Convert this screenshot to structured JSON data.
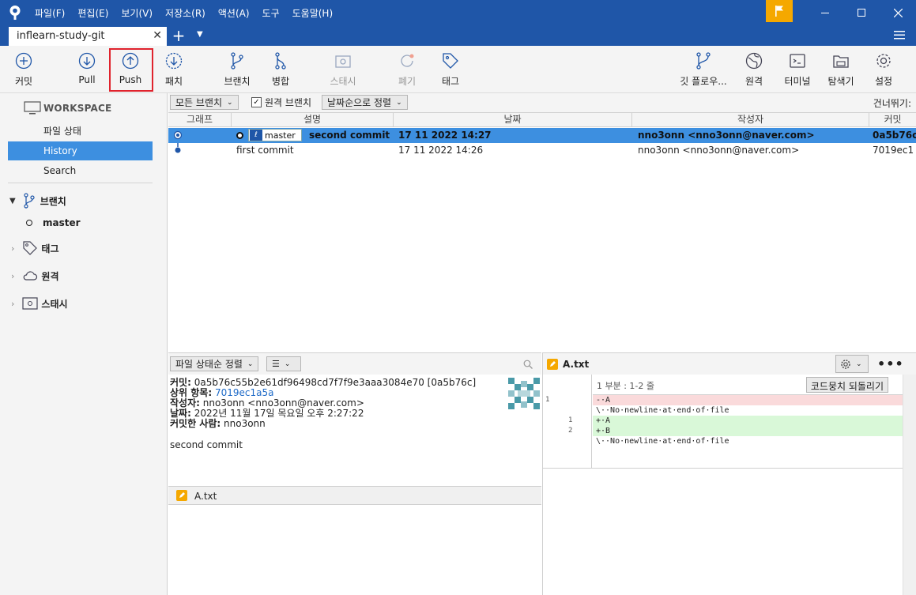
{
  "menubar": [
    "파일(F)",
    "편집(E)",
    "보기(V)",
    "저장소(R)",
    "액션(A)",
    "도구",
    "도움말(H)"
  ],
  "tab": {
    "title": "inflearn-study-git"
  },
  "toolbar": {
    "commit": "커밋",
    "pull": "Pull",
    "push": "Push",
    "fetch": "패치",
    "branch": "브랜치",
    "merge": "병합",
    "stash": "스태시",
    "discard": "폐기",
    "tag": "태그",
    "gitflow": "깃 플로우...",
    "remote": "원격",
    "terminal": "터미널",
    "explorer": "탐색기",
    "settings": "설정"
  },
  "sidebar": {
    "workspace": "WORKSPACE",
    "file_status": "파일 상태",
    "history": "History",
    "search": "Search",
    "branches": "브랜치",
    "branch_master": "master",
    "tags": "태그",
    "remotes": "원격",
    "stashes": "스태시"
  },
  "filter": {
    "all_branches": "모든 브랜치",
    "remote_branches": "원격 브랜치",
    "sort_by_date": "날짜순으로 정렬",
    "jump_to": "건너뛰기:"
  },
  "history": {
    "headers": {
      "graph": "그래프",
      "description": "설명",
      "date": "날짜",
      "author": "작성자",
      "commit": "커밋"
    },
    "rows": [
      {
        "branch": "master",
        "description": "second commit",
        "date": "17 11 2022 14:27",
        "author": "nno3onn <nno3onn@naver.com>",
        "commit": "0a5b76c"
      },
      {
        "description": "first commit",
        "date": "17 11 2022 14:26",
        "author": "nno3onn <nno3onn@naver.com>",
        "commit": "7019ec1"
      }
    ]
  },
  "details": {
    "sort_label": "파일 상태순 정렬",
    "commit_label": "커밋:",
    "commit_value": "0a5b76c55b2e61df96498cd7f7f9e3aaa3084e70 [0a5b76c]",
    "parent_label": "상위 항목:",
    "parent_value": "7019ec1a5a",
    "author_label": "작성자:",
    "author_value": "nno3onn <nno3onn@naver.com>",
    "date_label": "날짜:",
    "date_value": "2022년 11월 17일 목요일 오후 2:27:22",
    "committer_label": "커밋한 사람:",
    "committer_value": "nno3onn",
    "message": "second commit",
    "file": "A.txt"
  },
  "diff": {
    "file": "A.txt",
    "hunk": "1 부분 : 1-2 줄",
    "revert": "코드뭉치 되돌리기",
    "lines": [
      {
        "old": "1",
        "new": "",
        "text": "-·A",
        "type": "del"
      },
      {
        "old": "",
        "new": "",
        "text": "\\··No·newline·at·end·of·file",
        "type": "ctx"
      },
      {
        "old": "",
        "new": "1",
        "text": "+·A",
        "type": "add"
      },
      {
        "old": "",
        "new": "2",
        "text": "+·B",
        "type": "add"
      },
      {
        "old": "",
        "new": "",
        "text": "\\··No·newline·at·end·of·file",
        "type": "ctx"
      }
    ]
  },
  "colors": {
    "titlebar": "#1f56a8",
    "selection": "#3d8fe0",
    "accent_flag": "#f5a800",
    "highlight_box": "#e0232d"
  }
}
